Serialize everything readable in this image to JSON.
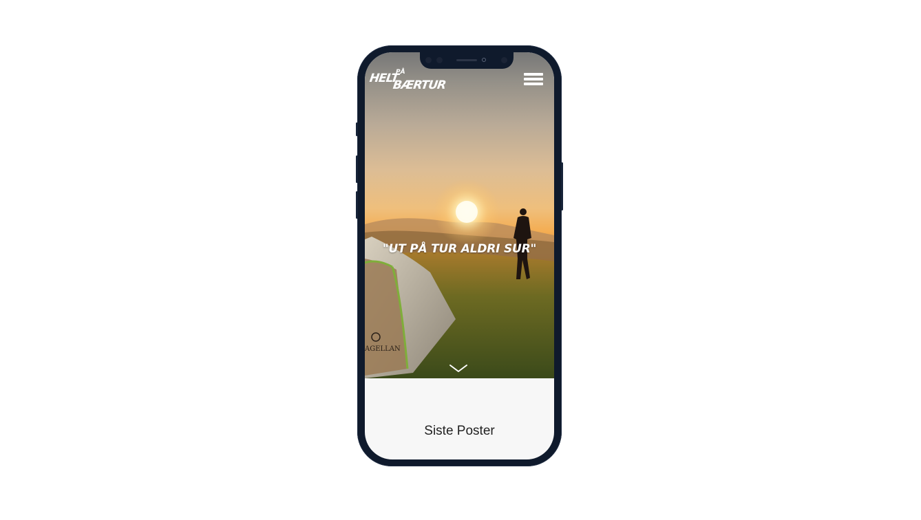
{
  "header": {
    "logo_line1": "HELT",
    "logo_small": "PÅ",
    "logo_line2": "BÆRTUR",
    "menu_icon": "hamburger-menu-icon"
  },
  "hero": {
    "tagline": "\"UT PÅ TUR ALDRI SUR\"",
    "scroll_icon": "chevron-down-icon",
    "tent_brand": "AGELLAN"
  },
  "section": {
    "title": "Siste Poster"
  },
  "colors": {
    "phone_frame": "#0f1a2c",
    "screen_bg": "#f7f7f7",
    "text_white": "#ffffff",
    "text_dark": "#222222"
  }
}
